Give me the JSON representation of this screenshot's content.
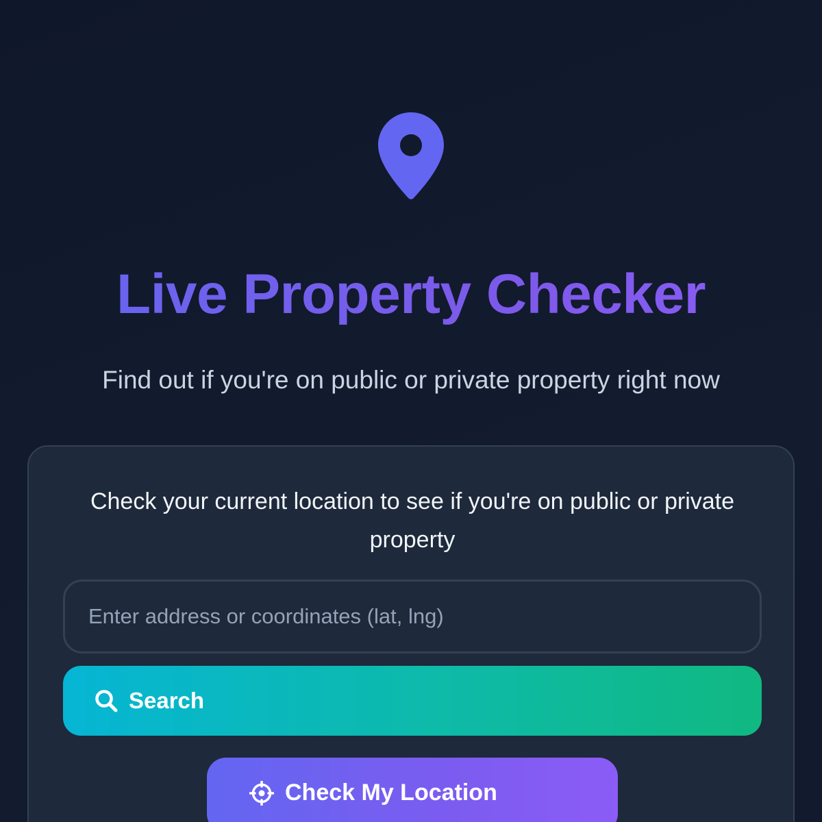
{
  "header": {
    "icon": "map-pin-icon",
    "title": "Live Property Checker",
    "subtitle": "Find out if you're on public or private property right now"
  },
  "card": {
    "description": "Check your current location to see if you're on public or private property",
    "search_input": {
      "value": "",
      "placeholder": "Enter address or coordinates (lat, lng)"
    },
    "search_button": {
      "icon": "search-icon",
      "label": "Search"
    },
    "location_button": {
      "icon": "crosshair-icon",
      "label": "Check My Location"
    }
  },
  "colors": {
    "background": "#0f172a",
    "card": "#1e293b",
    "accent_indigo": "#6366f1",
    "accent_violet": "#8b5cf6",
    "accent_cyan": "#06b6d4",
    "accent_green": "#10b981"
  }
}
